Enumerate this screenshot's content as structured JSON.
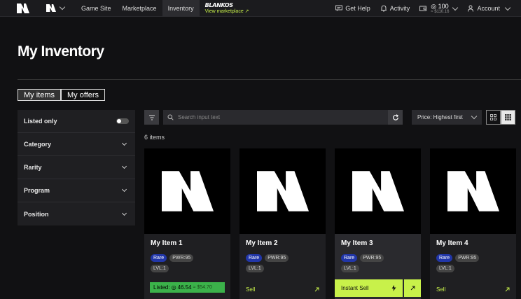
{
  "nav": {
    "links": [
      "Game Site",
      "Marketplace",
      "Inventory"
    ],
    "active": "Inventory",
    "blankos_logo": "BLANKOS",
    "view_marketplace": "View marketplace ↗",
    "get_help": "Get Help",
    "activity": "Activity",
    "balance": "100",
    "balance_usd": "≈ $110.16",
    "account": "Account"
  },
  "page": {
    "title": "My Inventory",
    "tabs": [
      "My items",
      "My offers"
    ]
  },
  "sidebar": {
    "listed_only": "Listed only",
    "filters": [
      "Category",
      "Rarity",
      "Program",
      "Position"
    ]
  },
  "toolbar": {
    "search_placeholder": "Search input text",
    "sort": "Price: Highest first"
  },
  "count_label": "6 items",
  "cards": [
    {
      "name": "My Item 1",
      "rarity": "Rare",
      "pwr": "PWR:95",
      "lvl": "LVL:1",
      "status": "listed",
      "listed_label": "Listed:",
      "listed_price": "46.54",
      "listed_usd": "≈ $54.70"
    },
    {
      "name": "My Item 2",
      "rarity": "Rare",
      "pwr": "PWR:95",
      "lvl": "LVL:1",
      "status": "sell",
      "action": "Sell"
    },
    {
      "name": "My Item 3",
      "rarity": "Rare",
      "pwr": "PWR:95",
      "lvl": "LVL:1",
      "status": "instant",
      "action": "Instant Sell"
    },
    {
      "name": "My Item 4",
      "rarity": "Rare",
      "pwr": "PWR:95",
      "lvl": "LVL:1",
      "status": "sell",
      "action": "Sell"
    }
  ],
  "colors": {
    "accent": "#c8f14a",
    "rare": "#2136a8",
    "listed": "#3bb24a"
  }
}
